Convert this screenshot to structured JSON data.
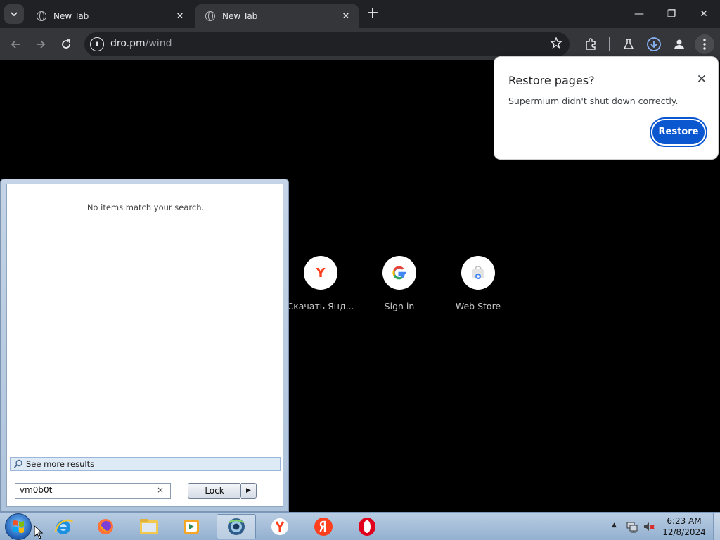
{
  "browser": {
    "tabs": [
      {
        "title": "New Tab",
        "close": "✕"
      },
      {
        "title": "New Tab",
        "close": "✕"
      }
    ],
    "new_tab_symbol": "+",
    "window_controls": {
      "minimize": "—",
      "restore": "❐",
      "close": "✕"
    },
    "address": {
      "info_symbol": "i",
      "host": "dro.pm",
      "path": "/wind"
    },
    "icons": [
      "tab-search-icon",
      "back-icon",
      "forward-icon",
      "reload-icon",
      "info-icon",
      "star-icon",
      "extensions-icon",
      "labs-icon",
      "download-icon",
      "profile-icon",
      "menu-icon"
    ]
  },
  "restore_popup": {
    "title": "Restore pages?",
    "close": "✕",
    "message": "Supermium didn't shut down correctly.",
    "button": "Restore",
    "button_color": "#0b57d0"
  },
  "shortcuts": [
    {
      "label": "Скачать Янд...",
      "icon": "Y"
    },
    {
      "label": "Sign in",
      "icon": "G"
    },
    {
      "label": "Web Store",
      "icon": "webstore-icon"
    }
  ],
  "start_menu": {
    "no_items": "No items match your search.",
    "see_more": "See more results",
    "search_value": "vm0b0t",
    "clear": "×",
    "lock_label": "Lock",
    "lock_arrow": "▶"
  },
  "taskbar": {
    "apps": [
      "internet-explorer-icon",
      "firefox-icon",
      "explorer-icon",
      "media-player-icon",
      "supermium-icon",
      "yandex-browser-icon",
      "yandex-icon",
      "opera-icon"
    ],
    "tray_arrow": "▲",
    "time": "6:23 AM",
    "date": "12/8/2024"
  }
}
